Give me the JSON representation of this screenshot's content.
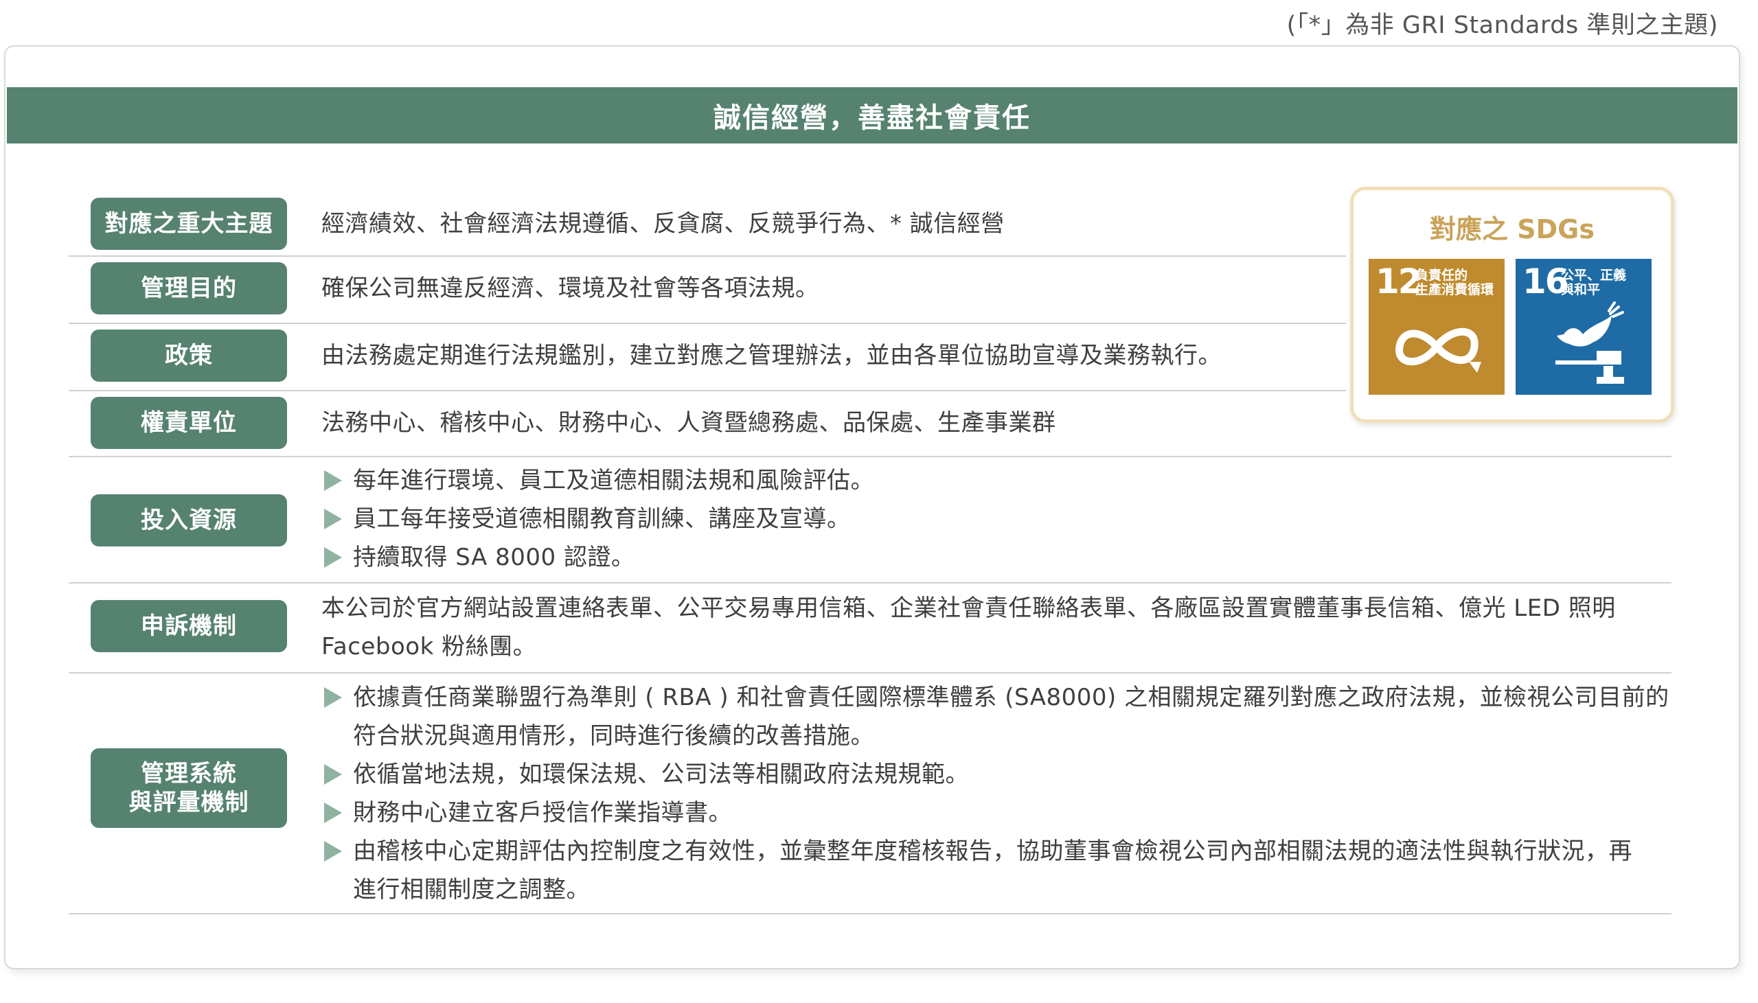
{
  "note": "(「*」為非 GRI Standards 準則之主題)",
  "banner_title": "誠信經營，善盡社會責任",
  "sdgs": {
    "title": "對應之 SDGs",
    "goals": [
      {
        "number": "12",
        "label_line1": "負責任的",
        "label_line2": "生產消費循環",
        "color": "#bf8b2e",
        "icon": "infinity-loop-icon"
      },
      {
        "number": "16",
        "label_line1": "公平、正義",
        "label_line2": "與和平",
        "color": "#1e6ba5",
        "icon": "dove-gavel-icon"
      }
    ]
  },
  "rows": [
    {
      "label": "對應之重大主題",
      "content": "經濟績效、社會經濟法規遵循、反貪腐、反競爭行為、* 誠信經營"
    },
    {
      "label": "管理目的",
      "content": "確保公司無違反經濟、環境及社會等各項法規。"
    },
    {
      "label": "政策",
      "content": "由法務處定期進行法規鑑別，建立對應之管理辦法，並由各單位協助宣導及業務執行。"
    },
    {
      "label": "權責單位",
      "content": "法務中心、稽核中心、財務中心、人資暨總務處、品保處、生產事業群"
    },
    {
      "label": "投入資源",
      "bullets": [
        "每年進行環境、員工及道德相關法規和風險評估。",
        "員工每年接受道德相關教育訓練、講座及宣導。",
        "持續取得 SA 8000 認證。"
      ]
    },
    {
      "label": "申訴機制",
      "content_lines": [
        "本公司於官方網站設置連絡表單、公平交易專用信箱、企業社會責任聯絡表單、各廠區設置實體董事長信箱、億光 LED 照明",
        "Facebook 粉絲團。"
      ]
    },
    {
      "label_line1": "管理系統",
      "label_line2": "與評量機制",
      "bullets": [
        [
          "依據責任商業聯盟行為準則 ( RBA ) 和社會責任國際標準體系 (SA8000) 之相關規定羅列對應之政府法規，並檢視公司目前的",
          "符合狀況與適用情形，同時進行後續的改善措施。"
        ],
        [
          "依循當地法規，如環保法規、公司法等相關政府法規規範。"
        ],
        [
          "財務中心建立客戶授信作業指導書。"
        ],
        [
          "由稽核中心定期評估內控制度之有效性，並彙整年度稽核報告，協助董事會檢視公司內部相關法規的適法性與執行狀況，再",
          "進行相關制度之調整。"
        ]
      ]
    }
  ]
}
